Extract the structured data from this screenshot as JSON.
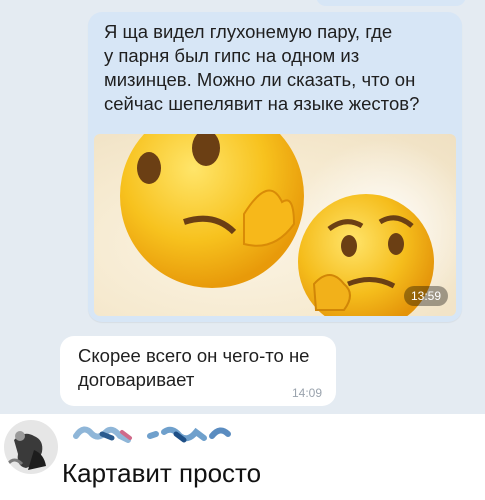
{
  "outgoing_message": {
    "text": "Я ща видел глухонемую пару, где\nу парня был гипс на одном из\nмизинцев. Можно ли сказать, что он\nсейчас шепелявит на языке жестов?",
    "image_icon": "thinking-face-emoji",
    "time": "13:59"
  },
  "incoming_message": {
    "text": "Скорее всего он чего-то не\nдоговаривает",
    "time": "14:09"
  },
  "comment": {
    "avatar_icon": "user-avatar",
    "text": "Картавит просто"
  },
  "colors": {
    "chat_bg": "#e4ebf2",
    "outgoing_bubble": "#d7e6f6",
    "incoming_bubble": "#ffffff",
    "emoji_yellow": "#f7c21e"
  }
}
